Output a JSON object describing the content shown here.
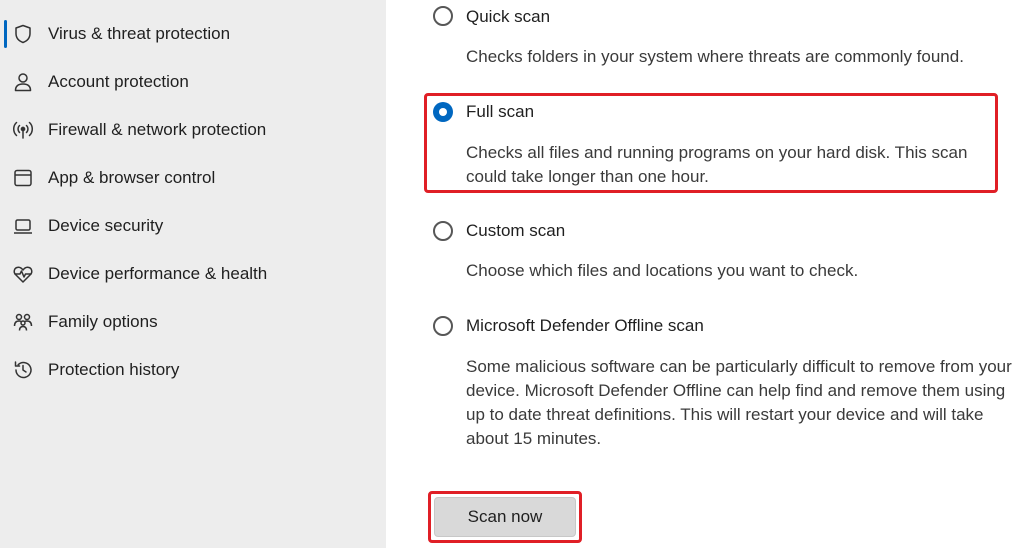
{
  "sidebar": {
    "items": [
      {
        "label": "Virus & threat protection",
        "icon": "shield-icon",
        "active": true
      },
      {
        "label": "Account protection",
        "icon": "person-icon"
      },
      {
        "label": "Firewall & network protection",
        "icon": "wireless-icon"
      },
      {
        "label": "App & browser control",
        "icon": "app-window-icon"
      },
      {
        "label": "Device security",
        "icon": "laptop-icon"
      },
      {
        "label": "Device performance & health",
        "icon": "heart-pulse-icon"
      },
      {
        "label": "Family options",
        "icon": "family-icon"
      },
      {
        "label": "Protection history",
        "icon": "history-icon"
      }
    ]
  },
  "scan_options": [
    {
      "title": "Quick scan",
      "description": "Checks folders in your system where threats are commonly found.",
      "selected": false
    },
    {
      "title": "Full scan",
      "description": "Checks all files and running programs on your hard disk. This scan could take longer than one hour.",
      "selected": true
    },
    {
      "title": "Custom scan",
      "description": "Choose which files and locations you want to check.",
      "selected": false
    },
    {
      "title": "Microsoft Defender Offline scan",
      "description": "Some malicious software can be particularly difficult to remove from your device. Microsoft Defender Offline can help find and remove them using up to date threat definitions. This will restart your device and will take about 15 minutes.",
      "selected": false
    }
  ],
  "scan_button": {
    "label": "Scan now"
  },
  "colors": {
    "accent": "#0067c0",
    "highlight": "#e01f26",
    "sidebar_bg": "#ededed"
  }
}
